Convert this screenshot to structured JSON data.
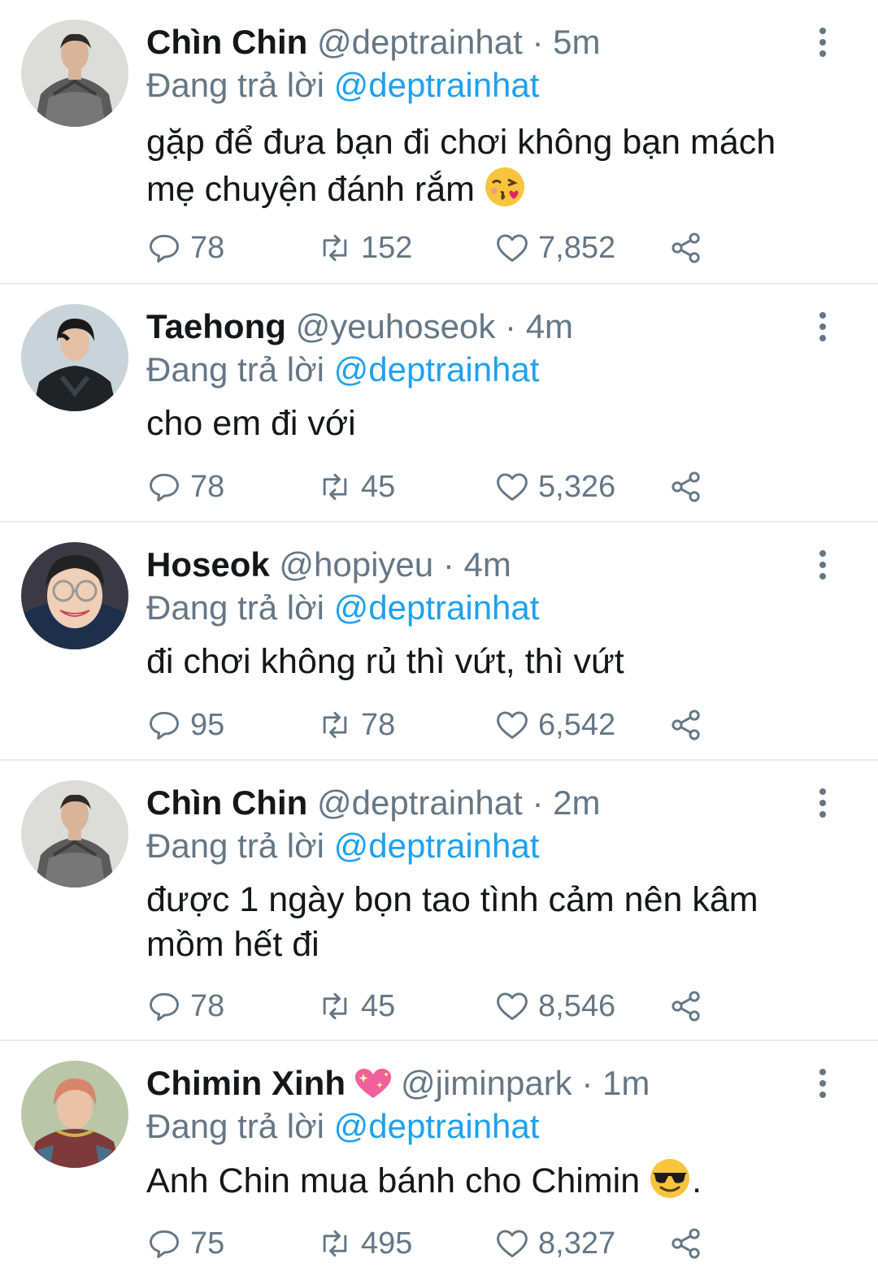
{
  "tweets": [
    {
      "name": "Chìn Chin",
      "handle": "@deptrainhat",
      "dot": "·",
      "time": "5m",
      "reply_prefix": "Đang trả lời",
      "reply_to": "@deptrainhat",
      "lines": [
        "gặp để đưa bạn đi chơi không bạn mách",
        "mẹ chuyện đánh rắm"
      ],
      "emoji": "kissing-face-with-heart",
      "replies": "78",
      "retweets": "152",
      "likes": "7,852"
    },
    {
      "name": "Taehong",
      "handle": "@yeuhoseok",
      "dot": "·",
      "time": "4m",
      "reply_prefix": "Đang trả lời",
      "reply_to": "@deptrainhat",
      "lines": [
        "cho em đi với"
      ],
      "replies": "78",
      "retweets": "45",
      "likes": "5,326"
    },
    {
      "name": "Hoseok",
      "handle": "@hopiyeu",
      "dot": "·",
      "time": "4m",
      "reply_prefix": "Đang trả lời",
      "reply_to": "@deptrainhat",
      "lines": [
        "đi chơi không rủ thì vứt, thì vứt"
      ],
      "replies": "95",
      "retweets": "78",
      "likes": "6,542"
    },
    {
      "name": "Chìn Chin",
      "handle": "@deptrainhat",
      "dot": "·",
      "time": "2m",
      "reply_prefix": "Đang trả lời",
      "reply_to": "@deptrainhat",
      "lines": [
        "được 1 ngày bọn tao tình cảm nên kâm",
        "mồm hết đi"
      ],
      "replies": "78",
      "retweets": "45",
      "likes": "8,546"
    },
    {
      "name": "Chimin Xinh",
      "badge": "sparkling-heart",
      "handle": "@jiminpark",
      "dot": "·",
      "time": "1m",
      "reply_prefix": "Đang trả lời",
      "reply_to": "@deptrainhat",
      "lines": [
        "Anh Chin mua bánh cho Chimin"
      ],
      "emoji": "sunglasses-face",
      "trailing": ".",
      "replies": "75",
      "retweets": "495",
      "likes": "8,327"
    }
  ],
  "colors": {
    "text": "#14171a",
    "secondary": "#657786",
    "link": "#1da1f2",
    "divider": "#e6ecf0"
  }
}
